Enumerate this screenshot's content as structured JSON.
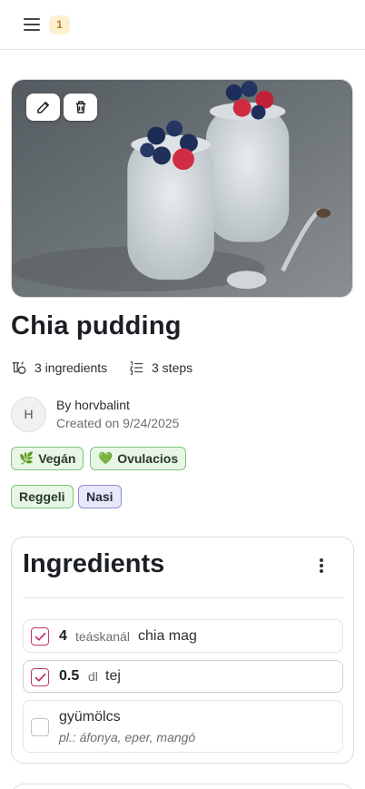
{
  "topbar": {
    "menu_icon": "hamburger-menu-icon",
    "notification_count": "1"
  },
  "hero": {
    "edit_icon": "pencil-icon",
    "delete_icon": "trash-icon"
  },
  "recipe": {
    "title": "Chia pudding",
    "ingredients_count": "3 ingredients",
    "steps_count": "3 steps",
    "avatar_initial": "H",
    "author": "By horvbalint",
    "created": "Created on 9/24/2025",
    "tags": [
      {
        "emoji": "🌿",
        "label": "Vegán",
        "color": "#e8f6e6"
      },
      {
        "emoji": "💚",
        "label": "Ovulacios",
        "color": "#e8f6e6"
      },
      {
        "label": "Reggeli",
        "color": "#e8f6e6"
      },
      {
        "label": "Nasi",
        "color": "#e8e8fb"
      }
    ]
  },
  "ingredients": {
    "heading": "Ingredients",
    "menu_icon": "kebab-menu-icon",
    "items": [
      {
        "checked": true,
        "quantity": "4",
        "unit": "teáskanál",
        "name": "chia mag"
      },
      {
        "checked": true,
        "quantity": "0.5",
        "unit": "dl",
        "name": "tej"
      },
      {
        "checked": false,
        "name": "gyümölcs",
        "note": "pl.: áfonya, eper, mangó"
      }
    ]
  },
  "colors": {
    "accent_check": "#c23574",
    "badge_bg": "#fdefcf",
    "badge_text": "#b57f1e"
  }
}
